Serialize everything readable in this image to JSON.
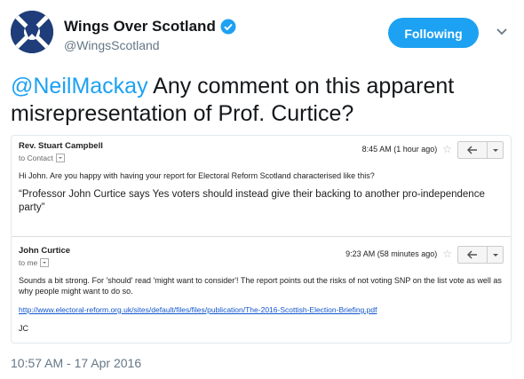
{
  "account": {
    "display_name": "Wings Over Scotland",
    "handle": "@WingsScotland",
    "follow_label": "Following"
  },
  "tweet": {
    "mention": "@NeilMackay",
    "text": " Any comment on this apparent misrepresentation of Prof. Curtice?",
    "timestamp": "10:57 AM - 17 Apr 2016"
  },
  "email_card": {
    "messages": [
      {
        "sender": "Rev. Stuart Campbell",
        "to_line": "to Contact",
        "time": "8:45 AM (1 hour ago)",
        "body": "Hi John. Are you happy with having your report for Electoral Reform Scotland characterised like this?",
        "quote": "“Professor John Curtice says Yes voters should instead give their backing to another pro-independence party”"
      },
      {
        "sender": "John Curtice",
        "to_line": "to me",
        "time": "9:23 AM (58 minutes ago)",
        "body": "Sounds a bit strong. For 'should' read 'might want to consider'! The report points out the risks of not voting SNP on the list vote as well as why people might want to do so.",
        "link": "http://www.electoral-reform.org.uk/sites/default/files/files/publication/The-2016-Scottish-Election-Briefing.pdf",
        "signature": "JC"
      }
    ]
  },
  "colors": {
    "accent": "#1da1f2",
    "avatar_bg": "#1f3d7a",
    "link": "#1155cc"
  },
  "icons": [
    "saltire-eagle-avatar",
    "verified-badge-icon",
    "chevron-down-icon",
    "star-icon",
    "reply-icon",
    "more-dropdown-icon"
  ]
}
